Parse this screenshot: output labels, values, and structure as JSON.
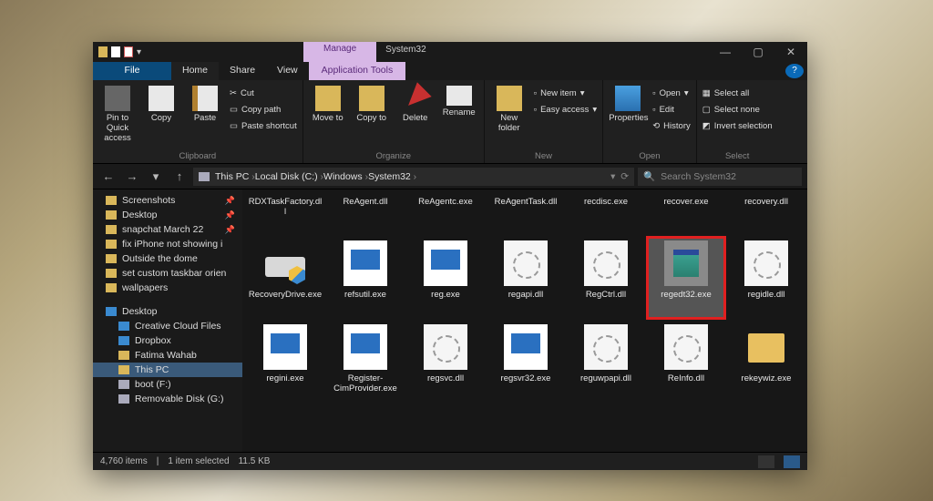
{
  "title_context": "Manage",
  "title_location": "System32",
  "menubar": {
    "file": "File",
    "home": "Home",
    "share": "Share",
    "view": "View",
    "apptools": "Application Tools"
  },
  "ribbon": {
    "clipboard": {
      "label": "Clipboard",
      "pin": "Pin to Quick access",
      "copy": "Copy",
      "paste": "Paste",
      "cut": "Cut",
      "copypath": "Copy path",
      "pasteshortcut": "Paste shortcut"
    },
    "organize": {
      "label": "Organize",
      "moveto": "Move to",
      "copyto": "Copy to",
      "delete": "Delete",
      "rename": "Rename"
    },
    "new": {
      "label": "New",
      "newfolder": "New folder",
      "newitem": "New item",
      "easyaccess": "Easy access"
    },
    "open": {
      "label": "Open",
      "properties": "Properties",
      "open": "Open",
      "edit": "Edit",
      "history": "History"
    },
    "select": {
      "label": "Select",
      "all": "Select all",
      "none": "Select none",
      "invert": "Invert selection"
    }
  },
  "breadcrumbs": [
    "This PC",
    "Local Disk (C:)",
    "Windows",
    "System32"
  ],
  "search_placeholder": "Search System32",
  "sidebar": {
    "quick": [
      {
        "label": "Screenshots",
        "pin": true
      },
      {
        "label": "Desktop",
        "pin": true
      },
      {
        "label": "snapchat March 22",
        "pin": true
      },
      {
        "label": "fix iPhone not showing i",
        "pin": false
      },
      {
        "label": "Outside the dome",
        "pin": false
      },
      {
        "label": "set custom taskbar orien",
        "pin": false
      },
      {
        "label": "wallpapers",
        "pin": false
      }
    ],
    "desktop": "Desktop",
    "desktop_children": [
      "Creative Cloud Files",
      "Dropbox",
      "Fatima Wahab",
      "This PC",
      "boot (F:)",
      "Removable Disk (G:)"
    ]
  },
  "files": [
    {
      "name": "RDXTaskFactory.dll",
      "type": "dll"
    },
    {
      "name": "ReAgent.dll",
      "type": "dll"
    },
    {
      "name": "ReAgentc.exe",
      "type": "exe"
    },
    {
      "name": "ReAgentTask.dll",
      "type": "dll"
    },
    {
      "name": "recdisc.exe",
      "type": "exeadmin"
    },
    {
      "name": "recover.exe",
      "type": "exe"
    },
    {
      "name": "recovery.dll",
      "type": "dll"
    },
    {
      "name": "RecoveryDrive.exe",
      "type": "recovdrv"
    },
    {
      "name": "refsutil.exe",
      "type": "exe"
    },
    {
      "name": "reg.exe",
      "type": "exe"
    },
    {
      "name": "regapi.dll",
      "type": "dll"
    },
    {
      "name": "RegCtrl.dll",
      "type": "dll"
    },
    {
      "name": "regedt32.exe",
      "type": "special",
      "selected": true,
      "highlight": true
    },
    {
      "name": "regidle.dll",
      "type": "dll"
    },
    {
      "name": "regini.exe",
      "type": "exe"
    },
    {
      "name": "Register-CimProvider.exe",
      "type": "exe"
    },
    {
      "name": "regsvc.dll",
      "type": "dll"
    },
    {
      "name": "regsvr32.exe",
      "type": "exe"
    },
    {
      "name": "reguwpapi.dll",
      "type": "dll"
    },
    {
      "name": "ReInfo.dll",
      "type": "dll"
    },
    {
      "name": "rekeywiz.exe",
      "type": "folder"
    }
  ],
  "status": {
    "count": "4,760 items",
    "selected": "1 item selected",
    "size": "11.5 KB"
  }
}
